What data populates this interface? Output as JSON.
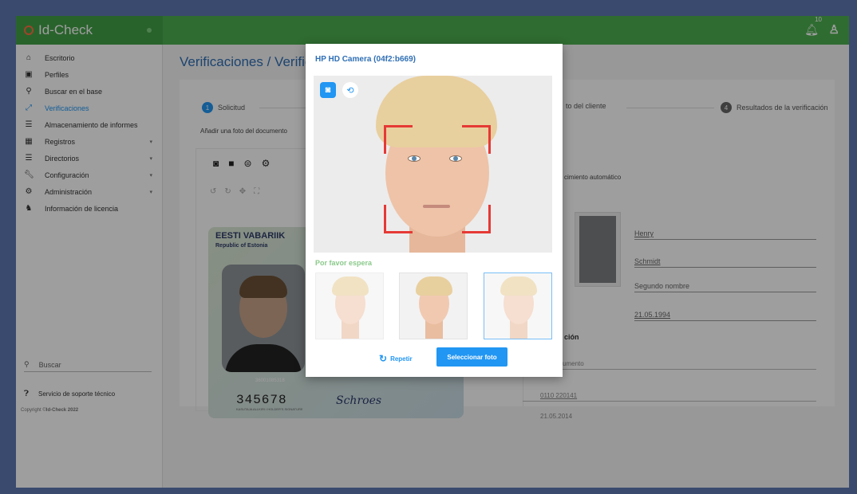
{
  "app": {
    "name": "Id-Check",
    "notifications_count": "10"
  },
  "sidebar": {
    "items": [
      {
        "label": "Escritorio",
        "icon": "home-icon"
      },
      {
        "label": "Perfiles",
        "icon": "id-card-icon"
      },
      {
        "label": "Buscar en el base",
        "icon": "search-icon"
      },
      {
        "label": "Verificaciones",
        "icon": "expand-icon",
        "active": true
      },
      {
        "label": "Almacenamiento de informes",
        "icon": "list-icon"
      },
      {
        "label": "Registros",
        "icon": "table-icon"
      },
      {
        "label": "Directorios",
        "icon": "list-icon"
      },
      {
        "label": "Configuración",
        "icon": "wrench-icon"
      },
      {
        "label": "Administración",
        "icon": "gear-icon"
      },
      {
        "label": "Información de licencia",
        "icon": "license-icon"
      }
    ],
    "search_placeholder": "Buscar",
    "support": "Servicio de soporte técnico",
    "copyright_prefix": "Copyright ©",
    "copyright_brand": "Id-Check 2022"
  },
  "page": {
    "title": "Verificaciones / Verific",
    "steps": [
      {
        "num": "1",
        "label": "Solicitud"
      },
      {
        "num": "",
        "label": "to del cliente"
      },
      {
        "num": "4",
        "label": "Resultados de la verificación"
      }
    ],
    "doc_label": "Añadir una foto del documento",
    "right": {
      "auto_label": "cimiento automático",
      "given_name": "Henry",
      "surname": "Schmidt",
      "second_name": "Segundo nombre",
      "birth_date": "21.05.1994",
      "section": "ción",
      "doc_field": "umento",
      "issue_code": "0110 220141",
      "issue_date": "21.05.2014"
    }
  },
  "id_card": {
    "country": "EESTI VABARIIK",
    "country_sub": "Republic of Estonia",
    "number": "345678",
    "holder_signature_label": "KASUTAJA ALLKIRI / HOLDER'S SIGNATURE",
    "photo_code": "36001085318",
    "signature": "Schroes"
  },
  "modal": {
    "title": "HP HD Camera (04f2:b669)",
    "wait_text": "Por favor espera",
    "repeat_label": "Repetir",
    "select_label": "Seleccionar foto"
  }
}
